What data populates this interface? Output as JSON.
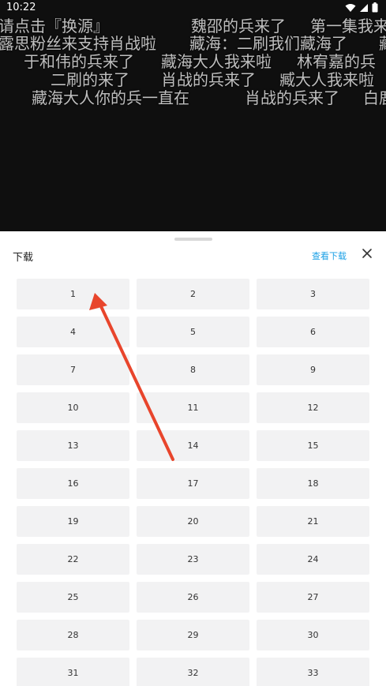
{
  "status_bar": {
    "time": "10:22"
  },
  "danmaku": [
    "请点击『换源』",
    "魏邵的兵来了",
    "第一集我来",
    "露思粉丝来支持肖战啦",
    "藏海：二刷我们藏海了",
    "藏",
    "于和伟的兵来了",
    "藏海大人我来啦",
    "林宥嘉的兵",
    "二刷的来了",
    "肖战的兵来了",
    "臧大人我来啦",
    "藏海大人你的兵一直在",
    "肖战的兵来了",
    "白鹿"
  ],
  "sheet": {
    "title": "下载",
    "view_downloads": "查看下载",
    "episodes": [
      "1",
      "2",
      "3",
      "4",
      "5",
      "6",
      "7",
      "8",
      "9",
      "10",
      "11",
      "12",
      "13",
      "14",
      "15",
      "16",
      "17",
      "18",
      "19",
      "20",
      "21",
      "22",
      "23",
      "24",
      "25",
      "26",
      "27",
      "28",
      "29",
      "30",
      "31",
      "32",
      "33"
    ]
  },
  "colors": {
    "accent": "#1aa0e6",
    "arrow": "#e8452c",
    "tile": "#f2f2f3"
  }
}
